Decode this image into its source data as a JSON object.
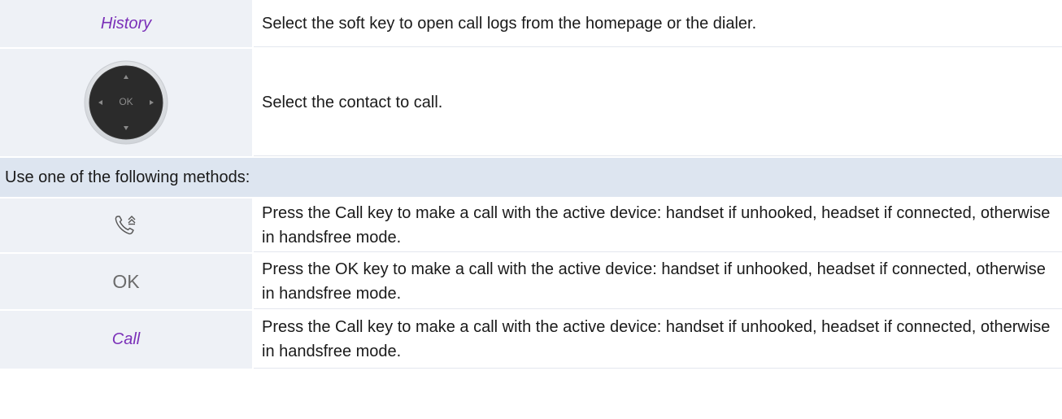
{
  "rows": [
    {
      "key_label": "History",
      "description": "Select the soft key to open call logs from the homepage or the dialer."
    },
    {
      "key_icon": "navigation-pad-icon",
      "key_icon_label": "OK",
      "description": "Select the contact to call."
    },
    {
      "section_heading": "Use one of the following methods:"
    },
    {
      "key_icon": "call-key-icon",
      "description": "Press the Call key to make a call with the active device: handset if unhooked, headset if connected, otherwise in handsfree mode."
    },
    {
      "key_label": "OK",
      "description": "Press the OK key to make a call with the active device: handset if unhooked, headset if connected, otherwise in handsfree mode."
    },
    {
      "key_label": "Call",
      "description": "Press the Call key to make a call with the active device: handset if unhooked, headset if connected, otherwise in handsfree mode."
    }
  ],
  "colors": {
    "softkey_text": "#7a2fb8",
    "key_cell_bg": "#eef1f6",
    "section_row_bg": "#dde5f0",
    "navpad_body": "#2b2b2b"
  }
}
